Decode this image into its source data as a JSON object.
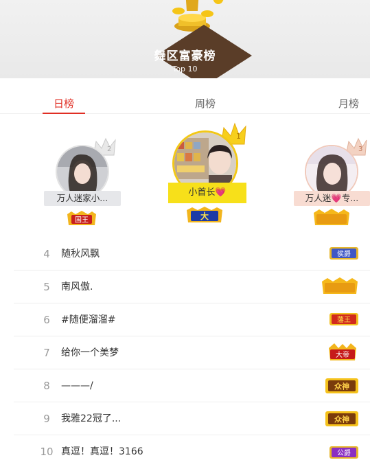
{
  "header": {
    "title": "舞区富豪榜",
    "subtitle": "Top 10",
    "colors": {
      "diamond": "#5a3d28",
      "gold": "#f5c518"
    }
  },
  "tabs": [
    {
      "label": "日榜",
      "active": true
    },
    {
      "label": "周榜",
      "active": false
    },
    {
      "label": "月榜",
      "active": false
    }
  ],
  "podium": [
    {
      "rank": 2,
      "name": "万人迷家小...",
      "badge": "国王",
      "crown_number": "2"
    },
    {
      "rank": 1,
      "name": "小首长💗",
      "badge": "大",
      "crown_number": "1"
    },
    {
      "rank": 3,
      "name": "万人迷💗专...",
      "badge": "",
      "crown_number": "3"
    }
  ],
  "ranking": [
    {
      "rank": "4",
      "name": "随秋风飘",
      "badge": "侯爵",
      "badge_style": "blue"
    },
    {
      "rank": "5",
      "name": "南风傲.",
      "badge": "",
      "badge_style": "gold-bar"
    },
    {
      "rank": "6",
      "name": "#随便溜溜#",
      "badge": "藩王",
      "badge_style": "red-gold"
    },
    {
      "rank": "7",
      "name": "给你一个美梦",
      "badge": "大帝",
      "badge_style": "red-crown"
    },
    {
      "rank": "8",
      "name": "———/",
      "badge": "众神",
      "badge_style": "dark-gold"
    },
    {
      "rank": "9",
      "name": "我雅22冠了...",
      "badge": "众神",
      "badge_style": "dark-gold"
    },
    {
      "rank": "10",
      "name": "真逗！真逗！3166",
      "badge": "公爵",
      "badge_style": "purple"
    }
  ]
}
